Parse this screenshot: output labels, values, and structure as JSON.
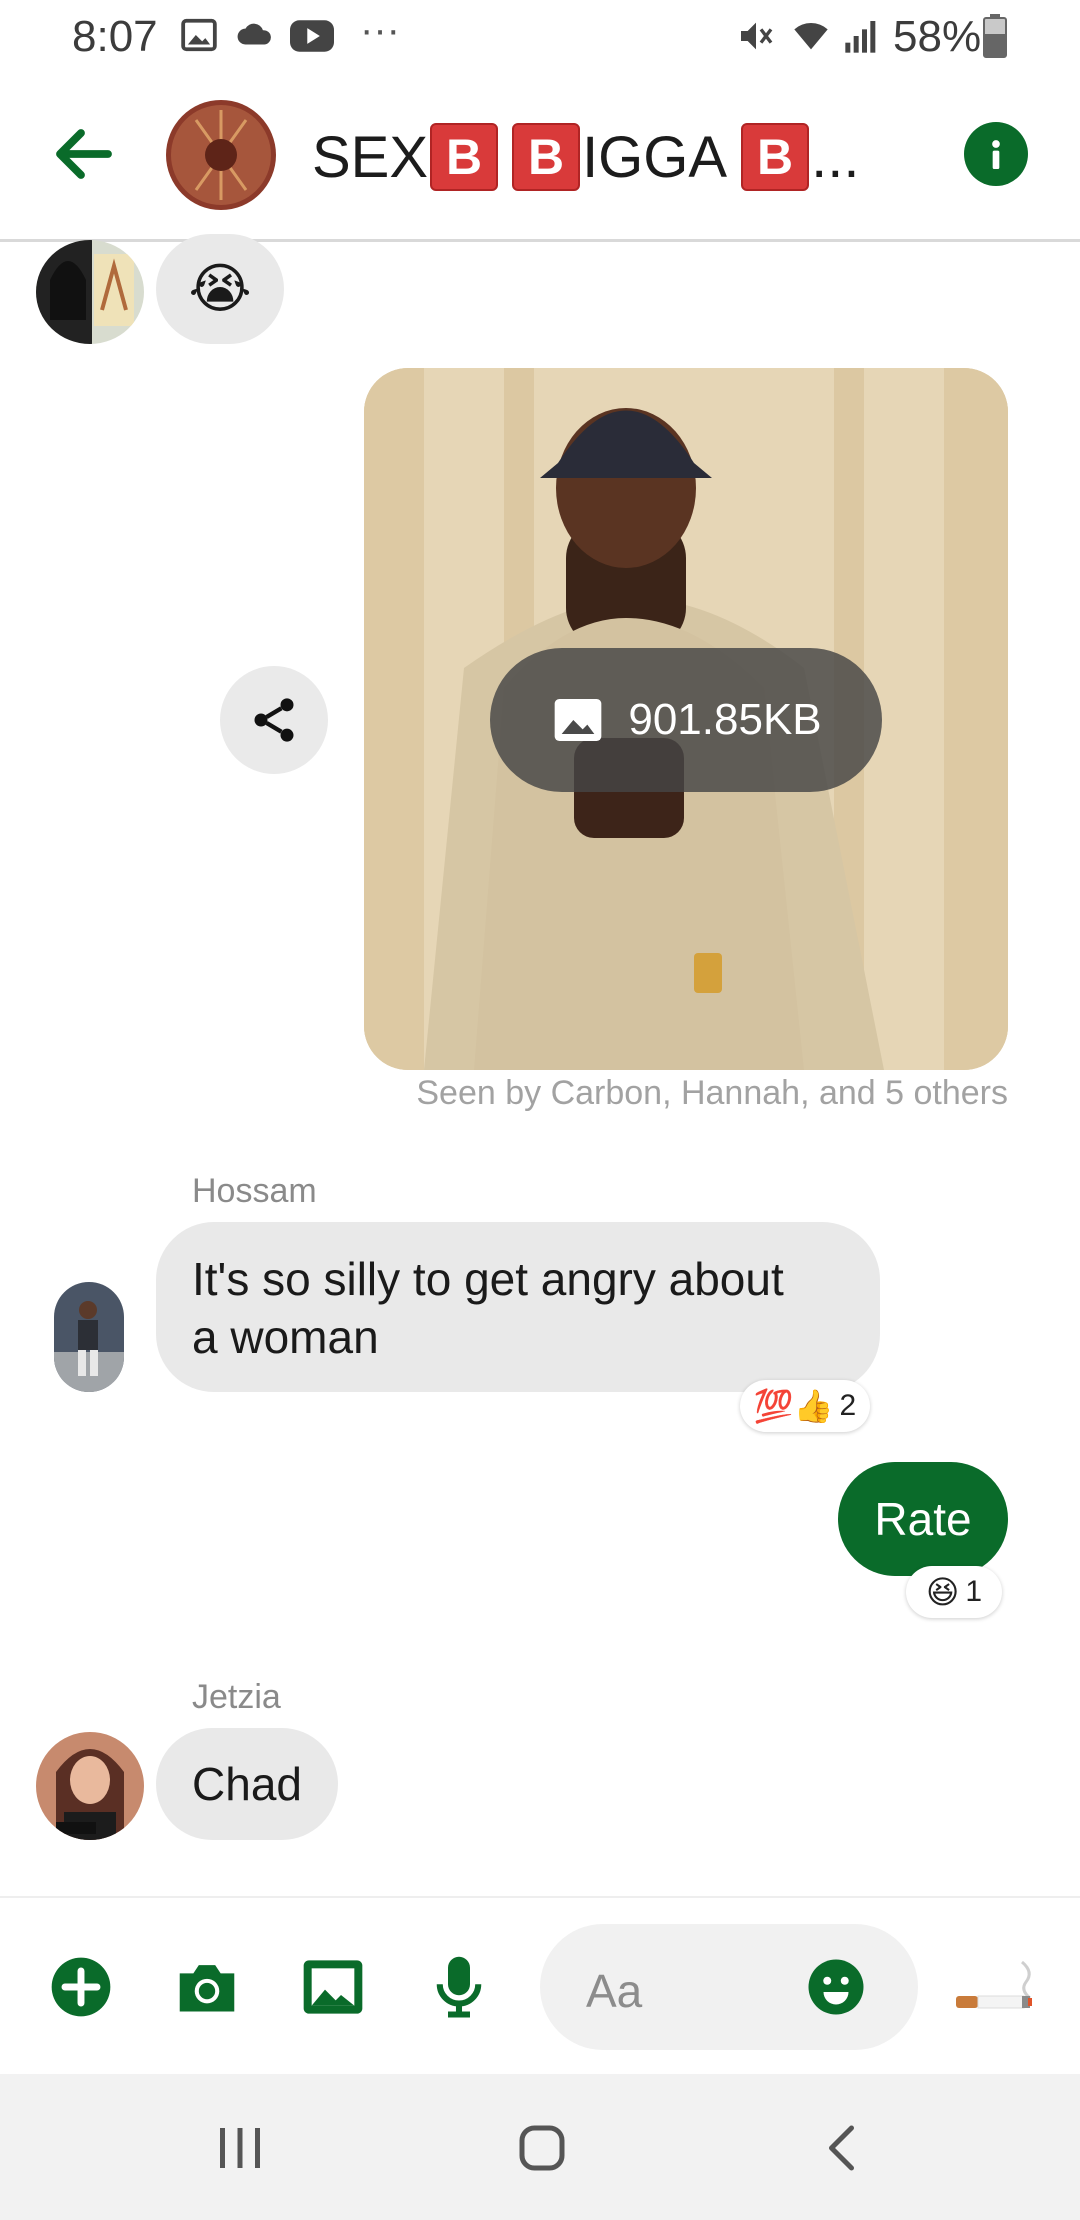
{
  "status_bar": {
    "time": "8:07",
    "battery": "58%",
    "more": "···"
  },
  "header": {
    "title_parts": [
      "SEX",
      "B",
      "B",
      "IGGA",
      "B",
      "..."
    ],
    "accent_color": "#0a6b2a"
  },
  "messages": {
    "first_reaction_emoji": "😭",
    "photo": {
      "size_label": "901.85KB"
    },
    "seen_label": "Seen by Carbon, Hannah, and 5 others",
    "hossam": {
      "sender": "Hossam",
      "line1": "It's so silly to get angry about",
      "line2": "a woman",
      "reactions": "💯👍",
      "reaction_count": "2"
    },
    "outgoing": {
      "text": "Rate",
      "reaction": "😆",
      "reaction_count": "1"
    },
    "jetzia": {
      "sender": "Jetzia",
      "text": "Chad"
    }
  },
  "composer": {
    "placeholder": "Aa"
  },
  "icons": [
    "arrow-left-icon",
    "info-icon",
    "share-icon",
    "image-icon",
    "plus-icon",
    "camera-icon",
    "gallery-icon",
    "microphone-icon",
    "smiley-icon",
    "cigarette-icon",
    "recents-icon",
    "home-icon",
    "back-icon"
  ]
}
